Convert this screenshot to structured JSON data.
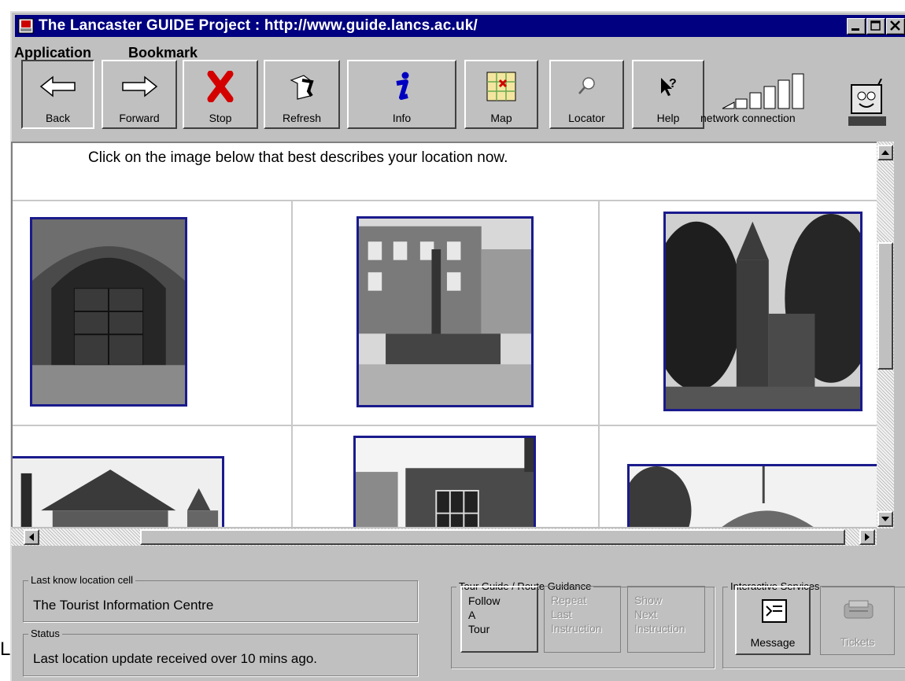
{
  "window": {
    "title": "The Lancaster GUIDE Project : http://www.guide.lancs.ac.uk/",
    "controls": [
      "minimize",
      "maximize",
      "close"
    ]
  },
  "menu": {
    "items": [
      "Application",
      "Bookmark"
    ]
  },
  "toolbar": {
    "back": "Back",
    "forward": "Forward",
    "stop": "Stop",
    "refresh": "Refresh",
    "info": "Info",
    "map": "Map",
    "locator": "Locator",
    "help": "Help",
    "network": "network connection"
  },
  "content": {
    "instruction": "Click on the image below that best describes your location now."
  },
  "status_panel": {
    "location_legend": "Last know location cell",
    "location_value": "The Tourist Information Centre",
    "status_legend": "Status",
    "status_value": "Last location update received over 10 mins ago."
  },
  "tour_guide": {
    "legend": "Tour Guide / Route Guidance",
    "follow": [
      "Follow",
      "A",
      "Tour"
    ],
    "repeat": [
      "Repeat",
      "Last",
      "Instruction"
    ],
    "show": [
      "Show",
      "Next",
      "Instruction"
    ]
  },
  "services": {
    "legend": "Interactive Services",
    "message": "Message",
    "tickets": "Tickets"
  },
  "edge_glyph": "L"
}
